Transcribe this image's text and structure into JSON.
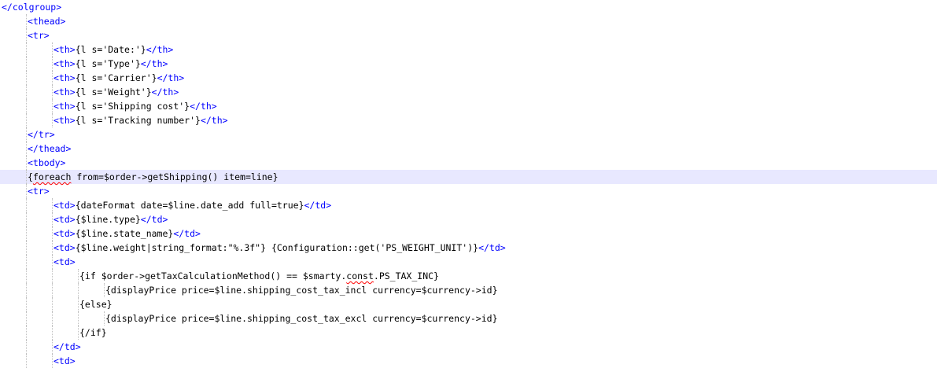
{
  "editor": {
    "current_line_index": 12,
    "colors": {
      "tag": "#0000ff",
      "text": "#000000",
      "current_line_bg": "#e8e8ff",
      "spell_underline": "#ff0000"
    },
    "lines": [
      {
        "indent": 0,
        "segments": [
          {
            "t": "</colgroup>",
            "k": "tag"
          }
        ]
      },
      {
        "indent": 1,
        "segments": [
          {
            "t": "<thead>",
            "k": "tag"
          }
        ]
      },
      {
        "indent": 1,
        "segments": [
          {
            "t": "<tr>",
            "k": "tag"
          }
        ]
      },
      {
        "indent": 2,
        "segments": [
          {
            "t": "<th>",
            "k": "tag"
          },
          {
            "t": "{l s='Date:'}",
            "k": "txt"
          },
          {
            "t": "</th>",
            "k": "tag"
          }
        ]
      },
      {
        "indent": 2,
        "segments": [
          {
            "t": "<th>",
            "k": "tag"
          },
          {
            "t": "{l s='Type'}",
            "k": "txt"
          },
          {
            "t": "</th>",
            "k": "tag"
          }
        ]
      },
      {
        "indent": 2,
        "segments": [
          {
            "t": "<th>",
            "k": "tag"
          },
          {
            "t": "{l s='Carrier'}",
            "k": "txt"
          },
          {
            "t": "</th>",
            "k": "tag"
          }
        ]
      },
      {
        "indent": 2,
        "segments": [
          {
            "t": "<th>",
            "k": "tag"
          },
          {
            "t": "{l s='Weight'}",
            "k": "txt"
          },
          {
            "t": "</th>",
            "k": "tag"
          }
        ]
      },
      {
        "indent": 2,
        "segments": [
          {
            "t": "<th>",
            "k": "tag"
          },
          {
            "t": "{l s='Shipping cost'}",
            "k": "txt"
          },
          {
            "t": "</th>",
            "k": "tag"
          }
        ]
      },
      {
        "indent": 2,
        "segments": [
          {
            "t": "<th>",
            "k": "tag"
          },
          {
            "t": "{l s='Tracking number'}",
            "k": "txt"
          },
          {
            "t": "</th>",
            "k": "tag"
          }
        ]
      },
      {
        "indent": 1,
        "segments": [
          {
            "t": "</tr>",
            "k": "tag"
          }
        ]
      },
      {
        "indent": 1,
        "segments": [
          {
            "t": "</thead>",
            "k": "tag"
          }
        ]
      },
      {
        "indent": 1,
        "segments": [
          {
            "t": "<tbody>",
            "k": "tag"
          }
        ]
      },
      {
        "indent": 1,
        "segments": [
          {
            "t": "{",
            "k": "txt"
          },
          {
            "t": "foreach",
            "k": "txt",
            "squiggle": true
          },
          {
            "t": " from=$order->getShipping() item=line}",
            "k": "txt"
          }
        ]
      },
      {
        "indent": 1,
        "segments": [
          {
            "t": "<tr>",
            "k": "tag"
          }
        ]
      },
      {
        "indent": 2,
        "segments": [
          {
            "t": "<td>",
            "k": "tag"
          },
          {
            "t": "{dateFormat date=$line.date_add full=true}",
            "k": "txt"
          },
          {
            "t": "</td>",
            "k": "tag"
          }
        ]
      },
      {
        "indent": 2,
        "segments": [
          {
            "t": "<td>",
            "k": "tag"
          },
          {
            "t": "{$line.type}",
            "k": "txt"
          },
          {
            "t": "</td>",
            "k": "tag"
          }
        ]
      },
      {
        "indent": 2,
        "segments": [
          {
            "t": "<td>",
            "k": "tag"
          },
          {
            "t": "{$line.state_name}",
            "k": "txt"
          },
          {
            "t": "</td>",
            "k": "tag"
          }
        ]
      },
      {
        "indent": 2,
        "segments": [
          {
            "t": "<td>",
            "k": "tag"
          },
          {
            "t": "{$line.weight|string_format:\"%.3f\"} {Configuration::get('PS_WEIGHT_UNIT')}",
            "k": "txt"
          },
          {
            "t": "</td>",
            "k": "tag"
          }
        ]
      },
      {
        "indent": 2,
        "segments": [
          {
            "t": "<td>",
            "k": "tag"
          }
        ]
      },
      {
        "indent": 3,
        "segments": [
          {
            "t": "{if $order->getTaxCalculationMethod() == $smarty.",
            "k": "txt"
          },
          {
            "t": "const",
            "k": "txt",
            "squiggle": true
          },
          {
            "t": ".PS_TAX_INC}",
            "k": "txt"
          }
        ]
      },
      {
        "indent": 4,
        "segments": [
          {
            "t": "{displayPrice price=$line.shipping_cost_tax_incl currency=$currency->id}",
            "k": "txt"
          }
        ]
      },
      {
        "indent": 3,
        "segments": [
          {
            "t": "{else}",
            "k": "txt"
          }
        ]
      },
      {
        "indent": 4,
        "segments": [
          {
            "t": "{displayPrice price=$line.shipping_cost_tax_excl currency=$currency->id}",
            "k": "txt"
          }
        ]
      },
      {
        "indent": 3,
        "segments": [
          {
            "t": "{/if}",
            "k": "txt"
          }
        ]
      },
      {
        "indent": 2,
        "segments": [
          {
            "t": "</td>",
            "k": "tag"
          }
        ]
      },
      {
        "indent": 2,
        "segments": [
          {
            "t": "<td>",
            "k": "tag"
          }
        ]
      }
    ]
  }
}
